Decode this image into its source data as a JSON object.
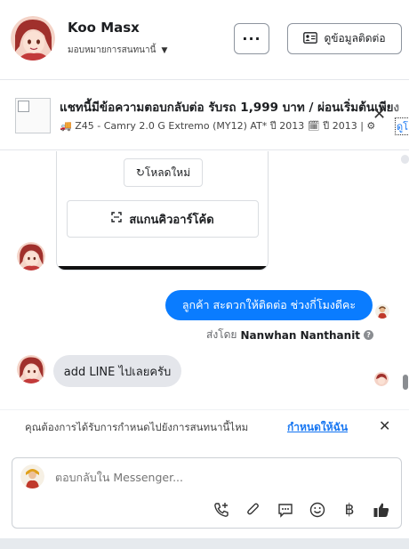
{
  "header": {
    "name": "Koo Masx",
    "assign_label": "มอบหมายการสนทนานี้",
    "more_label": "···",
    "info_button_label": "ดูข้อมูลติดต่อ"
  },
  "listing": {
    "title": "แชทนี้มีข้อความตอบกลับต่อ รับรถ 1,999 บาท / ผ่อนเริ่มต้นเพียง",
    "subtitle": "🚚 Z45 - Camry 2.0 G Extremo (MY12) AT* ปี 2013 🗓 ปี 2013 | ⚙",
    "view_link": "ดูโ"
  },
  "qr_card": {
    "reload_label": "↻โหลดใหม่",
    "scan_label": "สแกนคิวอาร์โค้ด"
  },
  "messages": {
    "outgoing_text": "ลูกค้า  สะดวกให้ติดต่อ ช่วงกี่โมงดีคะ",
    "sent_by_prefix": "ส่งโดย",
    "sent_by_name": "Nanwhan Nanthanit",
    "incoming_text": "add LINE ไปเลยครับ"
  },
  "assign_prompt": {
    "text": "คุณต้องการได้รับการกำหนดไปยังการสนทนานี้ไหม",
    "link": "กำหนดให้ฉัน"
  },
  "composer": {
    "placeholder": "ตอบกลับใน Messenger...",
    "icons": [
      "phone-add-icon",
      "paperclip-icon",
      "message-icon",
      "smile-icon",
      "baht-icon",
      "like-icon"
    ],
    "baht_symbol": "฿"
  },
  "colors": {
    "accent": "#0a7cff",
    "link": "#1877f2",
    "bubble_in": "#e4e6eb"
  }
}
